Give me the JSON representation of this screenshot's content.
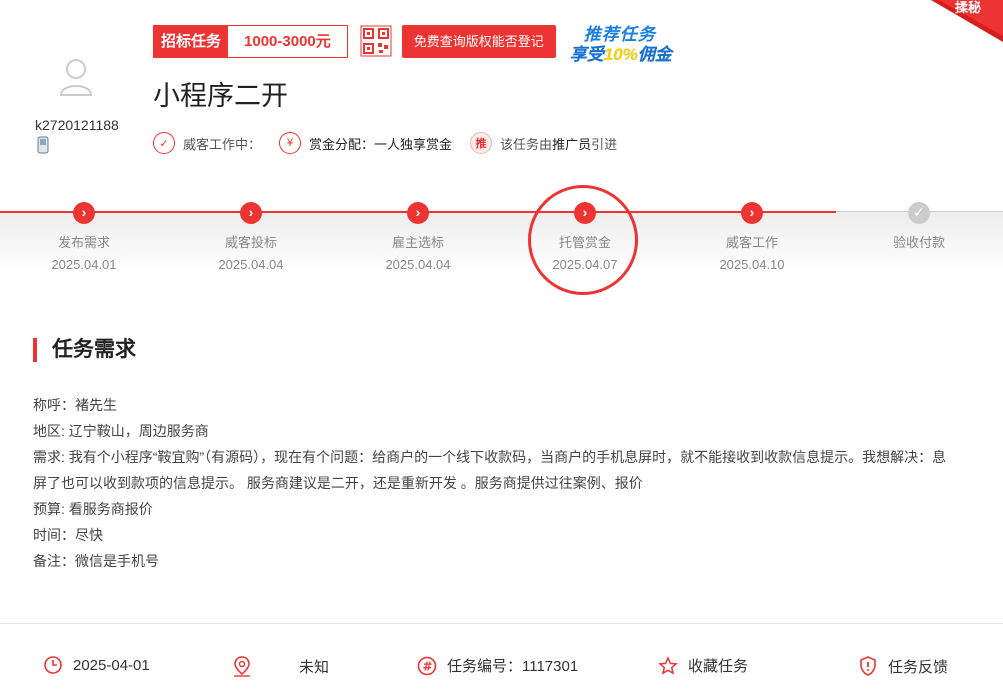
{
  "user": {
    "username": "k2720121188"
  },
  "bid": {
    "label": "招标任务",
    "amount": "1000-3000元"
  },
  "query_button": "免费查询版权能否登记",
  "promo": {
    "line1": "推荐任务",
    "line2_prefix": "享受",
    "line2_highlight": "10%",
    "line2_suffix": "佣金"
  },
  "corner_badge": "揉秘",
  "task": {
    "title": "小程序二开"
  },
  "meta": {
    "working_label": "威客工作中：",
    "reward_label": "赏金分配：",
    "reward_value": "一人独享赏金",
    "promo_icon": "推",
    "promo_text_prefix": "该任务由",
    "promo_text_strong": "推广员",
    "promo_text_suffix": "引进"
  },
  "steps": [
    {
      "name": "发布需求",
      "date": "2025.04.01",
      "done": true
    },
    {
      "name": "威客投标",
      "date": "2025.04.04",
      "done": true
    },
    {
      "name": "雇主选标",
      "date": "2025.04.04",
      "done": true
    },
    {
      "name": "托管赏金",
      "date": "2025.04.07",
      "done": true
    },
    {
      "name": "威客工作",
      "date": "2025.04.10",
      "done": true
    },
    {
      "name": "验收付款",
      "date": "",
      "done": false
    }
  ],
  "section": {
    "title": "任务需求",
    "lines": [
      "称呼：褚先生",
      "地区: 辽宁鞍山，周边服务商",
      "需求: 我有个小程序“鞍宜购”（有源码），现在有个问题：给商户的一个线下收款码，当商户的手机息屏时，就不能接收到收款信息提示。我想解决：息屏了也可以收到款项的信息提示。 服务商建议是二开，还是重新开发 。服务商提供过往案例、报价",
      "预算: 看服务商报价",
      "时间：尽快",
      "备注：微信是手机号"
    ]
  },
  "footer": {
    "date": "2025-04-01",
    "location": "未知",
    "task_no": "任务编号：1117301",
    "favorite": "收藏任务",
    "feedback": "任务反馈"
  },
  "colors": {
    "accent": "#ee3333",
    "promo_blue": "#1a7fe0"
  }
}
